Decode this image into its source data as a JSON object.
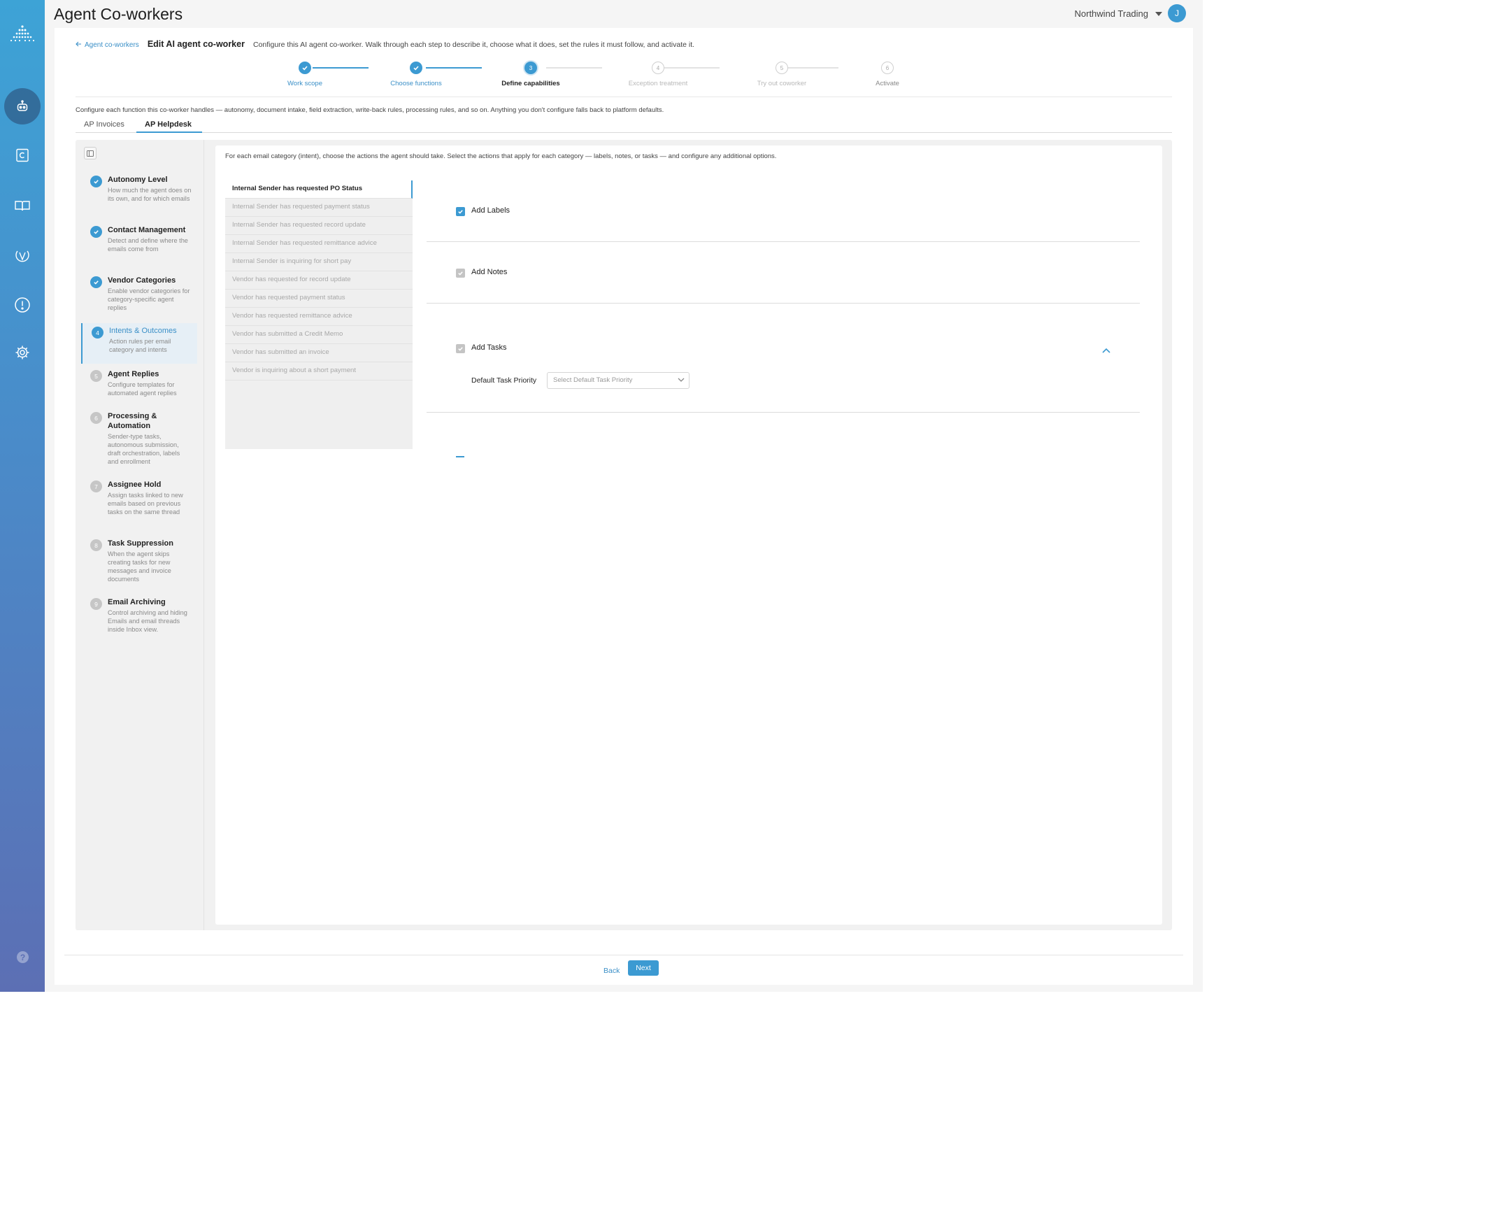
{
  "app": {
    "title": "Agent Co-workers",
    "org_name": "Northwind Trading",
    "avatar_initial": "J",
    "accent_color": "#3c9ad2"
  },
  "rail": {
    "items": [
      {
        "icon": "logo-icon"
      },
      {
        "icon": "robot-icon",
        "active": true
      },
      {
        "icon": "c-document-icon"
      },
      {
        "icon": "book-icon"
      },
      {
        "icon": "v-badge-icon"
      },
      {
        "icon": "alert-circle-icon"
      },
      {
        "icon": "gear-icon"
      }
    ],
    "help_label": "?"
  },
  "header": {
    "back_label": "Agent co-workers",
    "title": "Edit AI agent co-worker",
    "description": "Configure this AI agent co-worker. Walk through each step to describe it, choose what it does, set the rules it must follow, and activate it."
  },
  "stepper": {
    "steps": [
      {
        "number": "1",
        "label": "Work scope",
        "state": "done"
      },
      {
        "number": "2",
        "label": "Choose functions",
        "state": "done"
      },
      {
        "number": "3",
        "label": "Define capabilities",
        "state": "current"
      },
      {
        "number": "4",
        "label": "Exception treatment",
        "state": "todo"
      },
      {
        "number": "5",
        "label": "Try out coworker",
        "state": "todo"
      },
      {
        "number": "6",
        "label": "Activate",
        "state": "todo"
      }
    ]
  },
  "config": {
    "description": "Configure each function this co-worker handles — autonomy, document intake, field extraction, write-back rules, processing rules, and so on. Anything you don't configure falls back to platform defaults.",
    "tabs": [
      {
        "label": "AP Invoices",
        "active": false
      },
      {
        "label": "AP Helpdesk",
        "active": true
      }
    ]
  },
  "sidebar": {
    "items": [
      {
        "number": "1",
        "title": "Autonomy Level",
        "sub": "How much the agent does on its own, and for which emails",
        "state": "done"
      },
      {
        "number": "2",
        "title": "Contact Management",
        "sub": "Detect and define where the emails come from",
        "state": "done"
      },
      {
        "number": "3",
        "title": "Vendor Categories",
        "sub": "Enable vendor categories for category-specific agent replies",
        "state": "done"
      },
      {
        "number": "4",
        "title": "Intents & Outcomes",
        "sub": "Action rules per email category and intents",
        "state": "current"
      },
      {
        "number": "5",
        "title": "Agent Replies",
        "sub": "Configure templates for automated agent replies",
        "state": "todo"
      },
      {
        "number": "6",
        "title": "Processing & Automation",
        "sub": "Sender-type tasks, autonomous submission, draft orchestration, labels and enrollment",
        "state": "todo"
      },
      {
        "number": "7",
        "title": "Assignee Hold",
        "sub": "Assign tasks linked to new emails based on previous tasks on the same thread",
        "state": "todo"
      },
      {
        "number": "8",
        "title": "Task Suppression",
        "sub": "When the agent skips creating tasks for new messages and invoice documents",
        "state": "todo"
      },
      {
        "number": "9",
        "title": "Email Archiving",
        "sub": "Control archiving and hiding Emails and email threads inside Inbox view.",
        "state": "todo"
      }
    ]
  },
  "intents": {
    "description": "For each email category (intent), choose the actions the agent should take. Select the actions that apply for each category — labels, notes, or tasks — and configure any additional options.",
    "items": [
      {
        "label": "Internal Sender has requested PO Status",
        "active": true
      },
      {
        "label": "Internal Sender has requested payment status",
        "active": false
      },
      {
        "label": "Internal Sender has requested record update",
        "active": false
      },
      {
        "label": "Internal Sender has requested remittance advice",
        "active": false
      },
      {
        "label": "Internal Sender is inquiring for short pay",
        "active": false
      },
      {
        "label": "Vendor has requested for record update",
        "active": false
      },
      {
        "label": "Vendor has requested payment status",
        "active": false
      },
      {
        "label": "Vendor has requested remittance advice",
        "active": false
      },
      {
        "label": "Vendor has submitted a Credit Memo",
        "active": false
      },
      {
        "label": "Vendor has submitted an invoice",
        "active": false
      },
      {
        "label": "Vendor is inquiring about a short payment",
        "active": false
      }
    ]
  },
  "actions": {
    "add_labels": {
      "label": "Add Labels",
      "checked": true
    },
    "add_notes": {
      "label": "Add Notes",
      "checked": true
    },
    "add_tasks": {
      "label": "Add Tasks",
      "checked": true,
      "expanded": true
    },
    "priority_label": "Default Task Priority",
    "priority_placeholder": "Select Default Task Priority"
  },
  "footer": {
    "back_label": "Back",
    "next_label": "Next"
  }
}
